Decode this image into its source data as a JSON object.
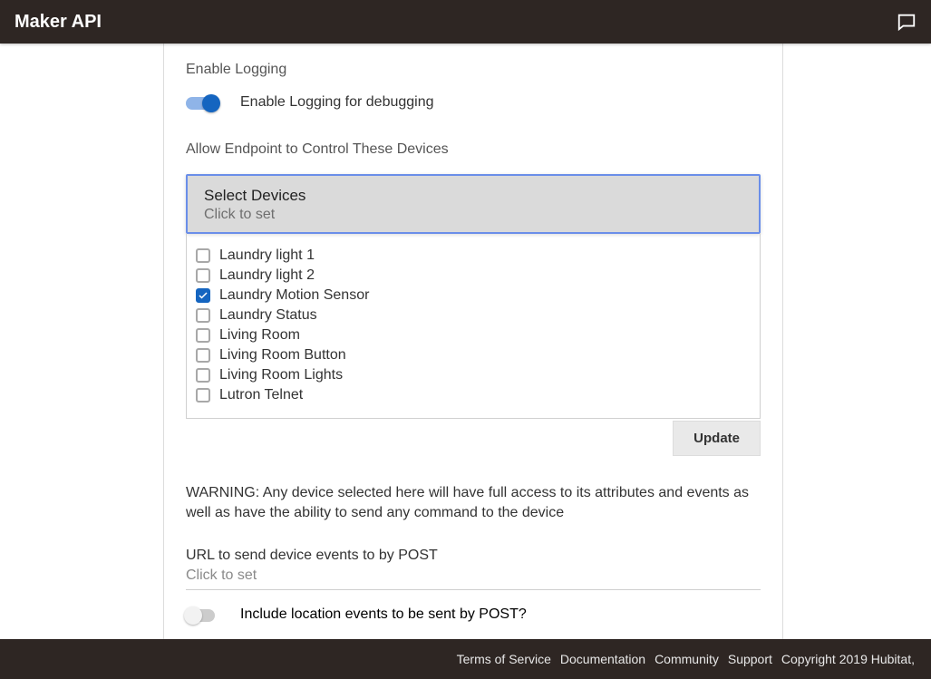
{
  "topbar": {
    "title": "Maker API"
  },
  "logging": {
    "section": "Enable Logging",
    "toggle_label": "Enable Logging for debugging",
    "enabled": true
  },
  "devices": {
    "section": "Allow Endpoint to Control These Devices",
    "select_title": "Select Devices",
    "select_sub": "Click to set",
    "items": [
      {
        "label": "Laundry light 1",
        "checked": false
      },
      {
        "label": "Laundry light 2",
        "checked": false
      },
      {
        "label": "Laundry Motion Sensor",
        "checked": true
      },
      {
        "label": "Laundry Status",
        "checked": false
      },
      {
        "label": "Living Room",
        "checked": false
      },
      {
        "label": "Living Room Button",
        "checked": false
      },
      {
        "label": "Living Room Lights",
        "checked": false
      },
      {
        "label": "Lutron Telnet",
        "checked": false
      }
    ],
    "update_label": "Update"
  },
  "warning_text": "WARNING: Any device selected here will have full access to its attributes and events as well as have the ability to send any command to the device",
  "url_post": {
    "label": "URL to send device events to by POST",
    "click_to_set": "Click to set"
  },
  "include_location": {
    "label": "Include location events to be sent by POST?",
    "enabled": false
  },
  "footer": {
    "links": [
      "Terms of Service",
      "Documentation",
      "Community",
      "Support"
    ],
    "copyright": "Copyright 2019 Hubitat,"
  }
}
